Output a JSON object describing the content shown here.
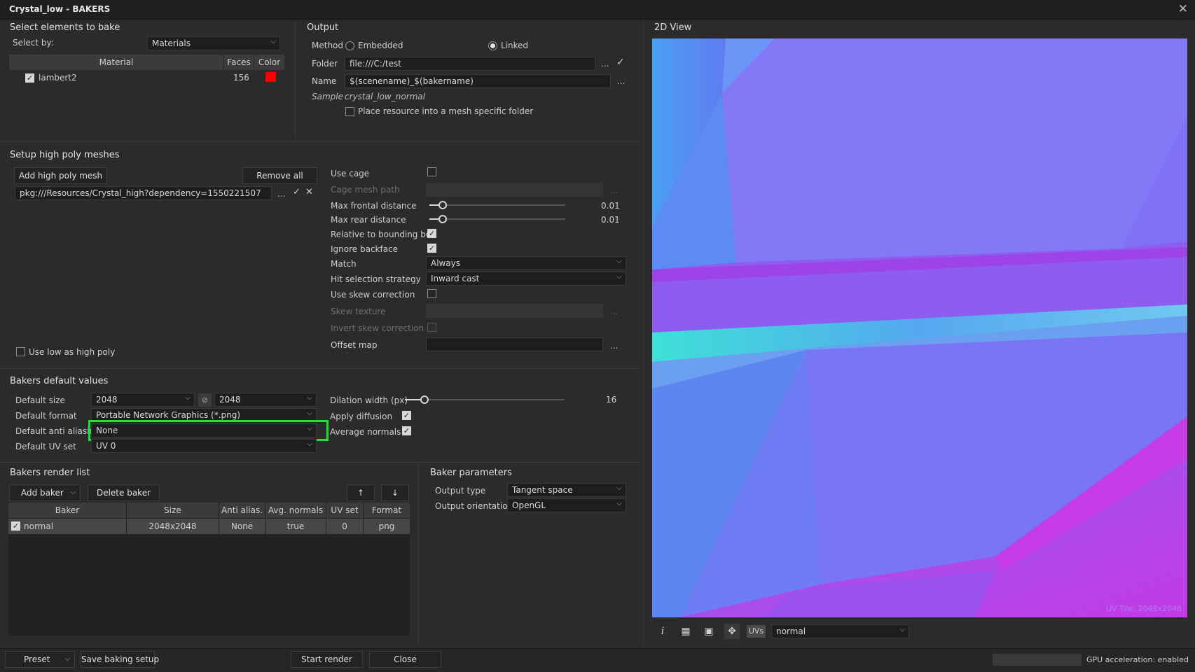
{
  "window": {
    "title": "Crystal_low - BAKERS"
  },
  "select_elements": {
    "title": "Select elements to bake",
    "select_by_label": "Select by:",
    "select_by_value": "Materials",
    "columns": [
      "Material",
      "Faces",
      "Color"
    ],
    "rows": [
      {
        "name": "lambert2",
        "faces": "156",
        "color": "#ff0000",
        "checked": true
      }
    ]
  },
  "output": {
    "title": "Output",
    "method_label": "Method",
    "method_embedded": "Embedded",
    "method_linked": "Linked",
    "method_selected": "Linked",
    "folder_label": "Folder",
    "folder_value": "file:///C:/test",
    "name_label": "Name",
    "name_value": "$(scenename)_$(bakername)",
    "sample_label": "Sample",
    "sample_value": "crystal_low_normal",
    "mesh_folder_label": "Place resource into a mesh specific folder",
    "dots": "..."
  },
  "high_poly": {
    "title": "Setup high poly meshes",
    "add_button": "Add high poly mesh",
    "remove_all": "Remove all",
    "mesh_path": "pkg:///Resources/Crystal_high?dependency=1550221507",
    "use_low_as_high": "Use low as high poly",
    "params": {
      "use_cage": "Use cage",
      "cage_mesh_path": "Cage mesh path",
      "max_frontal": "Max frontal distance",
      "max_frontal_value": "0.01",
      "max_rear": "Max rear distance",
      "max_rear_value": "0.01",
      "relative_bbox": "Relative to bounding box",
      "ignore_backface": "Ignore backface",
      "match": "Match",
      "match_value": "Always",
      "hit_strategy": "Hit selection strategy",
      "hit_strategy_value": "Inward cast",
      "use_skew": "Use skew correction",
      "skew_texture": "Skew texture",
      "invert_skew": "Invert skew correction",
      "offset_map": "Offset map"
    }
  },
  "defaults": {
    "title": "Bakers default values",
    "size_label": "Default size",
    "size_w": "2048",
    "size_h": "2048",
    "format_label": "Default format",
    "format_value": "Portable Network Graphics (*.png)",
    "aa_label": "Default anti aliasing",
    "aa_value": "None",
    "uv_label": "Default UV set",
    "uv_value": "UV 0",
    "dilation_label": "Dilation width (px)",
    "dilation_value": "16",
    "apply_diffusion": "Apply diffusion",
    "average_normals": "Average normals"
  },
  "render_list": {
    "title": "Bakers render list",
    "add_baker": "Add baker",
    "delete_baker": "Delete baker",
    "up": "↑",
    "down": "↓",
    "columns": [
      "Baker",
      "Size",
      "Anti alias.",
      "Avg. normals",
      "UV set",
      "Format"
    ],
    "rows": [
      {
        "baker": "normal",
        "size": "2048x2048",
        "aa": "None",
        "avg": "true",
        "uv": "0",
        "format": "png"
      }
    ]
  },
  "baker_params": {
    "title": "Baker parameters",
    "output_type_label": "Output type",
    "output_type_value": "Tangent space",
    "orientation_label": "Output orientation",
    "orientation_value": "OpenGL"
  },
  "view2d": {
    "title": "2D View",
    "watermark": "UV Tile: 2048x2048",
    "uvs_button": "UVs",
    "channel_value": "normal"
  },
  "footer": {
    "preset": "Preset",
    "save_setup": "Save baking setup",
    "start_render": "Start render",
    "close": "Close",
    "gpu": "GPU acceleration: enabled"
  }
}
